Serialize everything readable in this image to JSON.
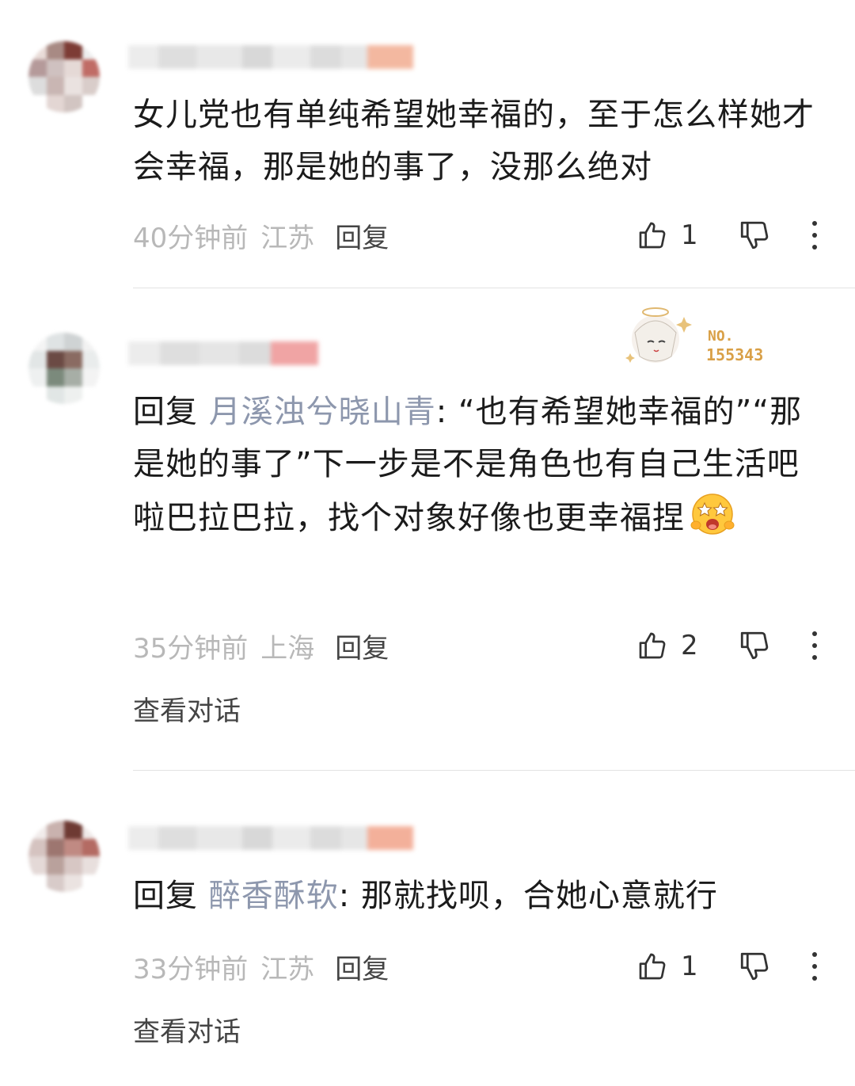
{
  "comments": [
    {
      "text": "女儿党也有单纯希望她幸福的，至于怎么样她才会幸福，那是她的事了，没那么绝对",
      "time": "40分钟前",
      "location": "江苏",
      "reply_label": "回复",
      "likes": "1"
    },
    {
      "reply_prefix": "回复",
      "mention": "月溪浊兮晓山青",
      "text": ": “也有希望她幸福的”“那是她的事了”下一步是不是角色也有自己生活吧啦巴拉巴拉，找个对象好像也更幸福捏",
      "time": "35分钟前",
      "location": "上海",
      "reply_label": "回复",
      "likes": "2",
      "view_conversation": "查看对话",
      "badge": {
        "line1": "NO.",
        "line2": "155343"
      }
    },
    {
      "reply_prefix": "回复",
      "mention": "醉香酥软",
      "text": ": 那就找呗，合她心意就行",
      "time": "33分钟前",
      "location": "江苏",
      "reply_label": "回复",
      "likes": "1",
      "view_conversation": "查看对话"
    }
  ],
  "icons": {
    "like": "thumbs-up-icon",
    "dislike": "thumbs-down-icon",
    "more": "more-vertical-icon",
    "emoji": "star-eyes-emoji-icon"
  },
  "colors": {
    "mention": "#8d97ad",
    "meta": "#b8b8b8",
    "text": "#1b1b1b"
  }
}
